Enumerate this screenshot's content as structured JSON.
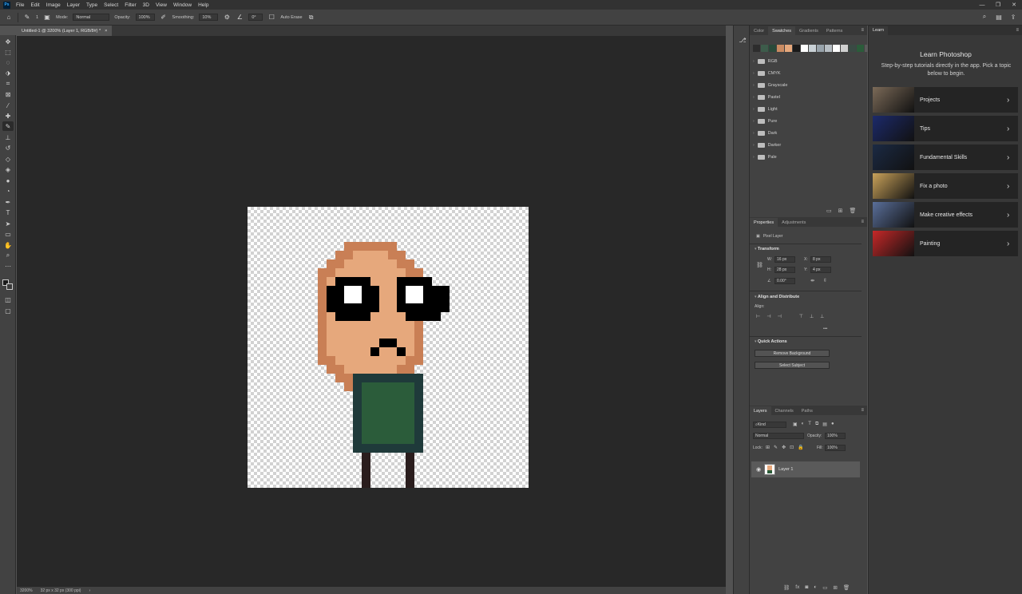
{
  "app": {
    "logo": "Ps"
  },
  "menu": [
    "File",
    "Edit",
    "Image",
    "Layer",
    "Type",
    "Select",
    "Filter",
    "3D",
    "View",
    "Window",
    "Help"
  ],
  "options_bar": {
    "mode_label": "Mode:",
    "mode_value": "Normal",
    "opacity_label": "Opacity:",
    "opacity_value": "100%",
    "smoothing_label": "Smoothing:",
    "smoothing_value": "10%",
    "angle_value": "0°",
    "auto_erase_label": "Auto Erase",
    "brush_size": "1"
  },
  "document": {
    "tab_title": "Untitled-1 @ 3200% (Layer 1, RGB/8#) *",
    "close": "×"
  },
  "status": {
    "zoom": "3200%",
    "doc_size": "32 px x 32 px (300 ppi)",
    "arrow": "›"
  },
  "swatches_panel": {
    "tabs": [
      "Color",
      "Swatches",
      "Gradients",
      "Patterns"
    ],
    "active_tab": "Swatches",
    "swatch_colors": [
      "#2d2d2d",
      "#3d5c4b",
      "#2a4a3a",
      "#ca8b62",
      "#e6a87c",
      "#1a1a1a",
      "#ffffff",
      "#c9d1d6",
      "#98a3ab",
      "#b7bec4",
      "#ffffff",
      "#d0d0d0",
      "#3a4a44",
      "#2b5c3a",
      "#5a5a5a",
      "#ffffff",
      "#000000"
    ],
    "groups": [
      "RGB",
      "CMYK",
      "Grayscale",
      "Pastel",
      "Light",
      "Pure",
      "Dark",
      "Darker",
      "Pale"
    ]
  },
  "properties_panel": {
    "tabs": [
      "Properties",
      "Adjustments"
    ],
    "layer_type": "Pixel Layer",
    "transform_title": "Transform",
    "w_label": "W:",
    "w_value": "16 px",
    "h_label": "H:",
    "h_value": "28 px",
    "x_label": "X:",
    "x_value": "8 px",
    "y_label": "Y:",
    "y_value": "4 px",
    "angle_value": "0.00°",
    "align_title": "Align and Distribute",
    "align_label": "Align:",
    "quick_actions_title": "Quick Actions",
    "remove_bg_label": "Remove Background",
    "select_subject_label": "Select Subject",
    "more": "•••"
  },
  "layers_panel": {
    "tabs": [
      "Layers",
      "Channels",
      "Paths"
    ],
    "filter_kind": "Kind",
    "blend_mode": "Normal",
    "opacity_label": "Opacity:",
    "opacity_value": "100%",
    "lock_label": "Lock:",
    "fill_label": "Fill:",
    "fill_value": "100%",
    "layer_name": "Layer 1"
  },
  "learn_panel": {
    "tab": "Learn",
    "title": "Learn Photoshop",
    "subtitle": "Step-by-step tutorials directly in the app. Pick a topic below to begin.",
    "cards": [
      {
        "label": "Projects",
        "thumb": "#7b6a58"
      },
      {
        "label": "Tips",
        "thumb": "#1c2a6b"
      },
      {
        "label": "Fundamental Skills",
        "thumb": "#1b2a44"
      },
      {
        "label": "Fix a photo",
        "thumb": "#c9a25a"
      },
      {
        "label": "Make creative effects",
        "thumb": "#5a6f9a"
      },
      {
        "label": "Painting",
        "thumb": "#c62828"
      }
    ]
  },
  "colors": {
    "skin": "#e6a87c",
    "skin_dark": "#c97f55",
    "eye_black": "#000000",
    "eye_white": "#ffffff",
    "body_green": "#2b5c3a",
    "body_outline": "#1f3a3a",
    "legs": "#2a1d1d"
  }
}
